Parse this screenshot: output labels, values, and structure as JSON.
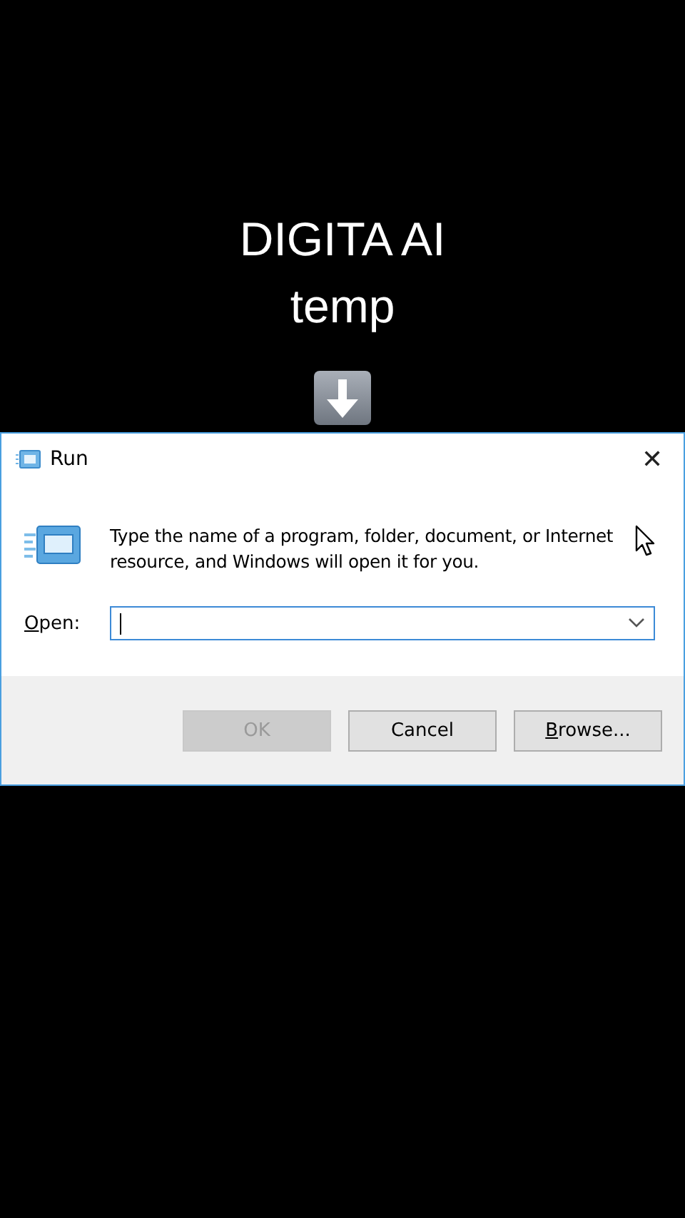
{
  "caption": {
    "lines": [
      "DIGITA AI",
      "temp"
    ],
    "arrow_badge": true
  },
  "window": {
    "title": "Run",
    "close": "✕"
  },
  "message": "Type the name of a program, folder, document, or Internet resource, and Windows will open it for you.",
  "open_field": {
    "label": "Open:",
    "label_mnemonic": true,
    "focused": true
  },
  "buttons": [
    {
      "label": "OK",
      "disabled": true,
      "mnemonic": false
    },
    {
      "label": "Cancel",
      "disabled": false,
      "mnemonic": false
    },
    {
      "label": "Browse...",
      "disabled": false,
      "mnemonic": true
    }
  ]
}
